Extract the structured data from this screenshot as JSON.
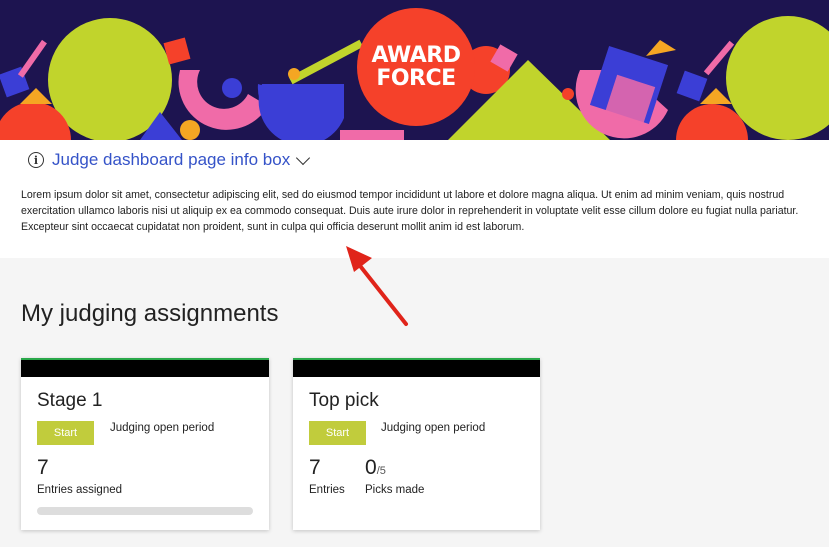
{
  "banner": {
    "logo_line1": "AWARD",
    "logo_line2": "FORCE",
    "colors": {
      "background": "#1d1450",
      "lime": "#c1d42c",
      "red": "#f5412a",
      "pink": "#f06ba8",
      "blue": "#3b3ed6",
      "orange": "#f5a623"
    }
  },
  "info_box": {
    "title": "Judge dashboard page info box",
    "body": "Lorem ipsum dolor sit amet, consectetur adipiscing elit, sed do eiusmod tempor incididunt ut labore et dolore magna aliqua. Ut enim ad minim veniam, quis nostrud exercitation ullamco laboris nisi ut aliquip ex ea commodo consequat. Duis aute irure dolor in reprehenderit in voluptate velit esse cillum dolore eu fugiat nulla pariatur. Excepteur sint occaecat cupidatat non proident, sunt in culpa qui officia deserunt mollit anim id est laborum."
  },
  "assignments": {
    "heading": "My judging assignments",
    "cards": [
      {
        "title": "Stage 1",
        "start_label": "Start",
        "period": "Judging open period",
        "count": "7",
        "count_label": "Entries assigned",
        "progress": 0
      },
      {
        "title": "Top pick",
        "start_label": "Start",
        "period": "Judging open period",
        "count": "7",
        "count_label": "Entries",
        "picks": "0",
        "picks_total": "/5",
        "picks_label": "Picks made"
      }
    ]
  }
}
